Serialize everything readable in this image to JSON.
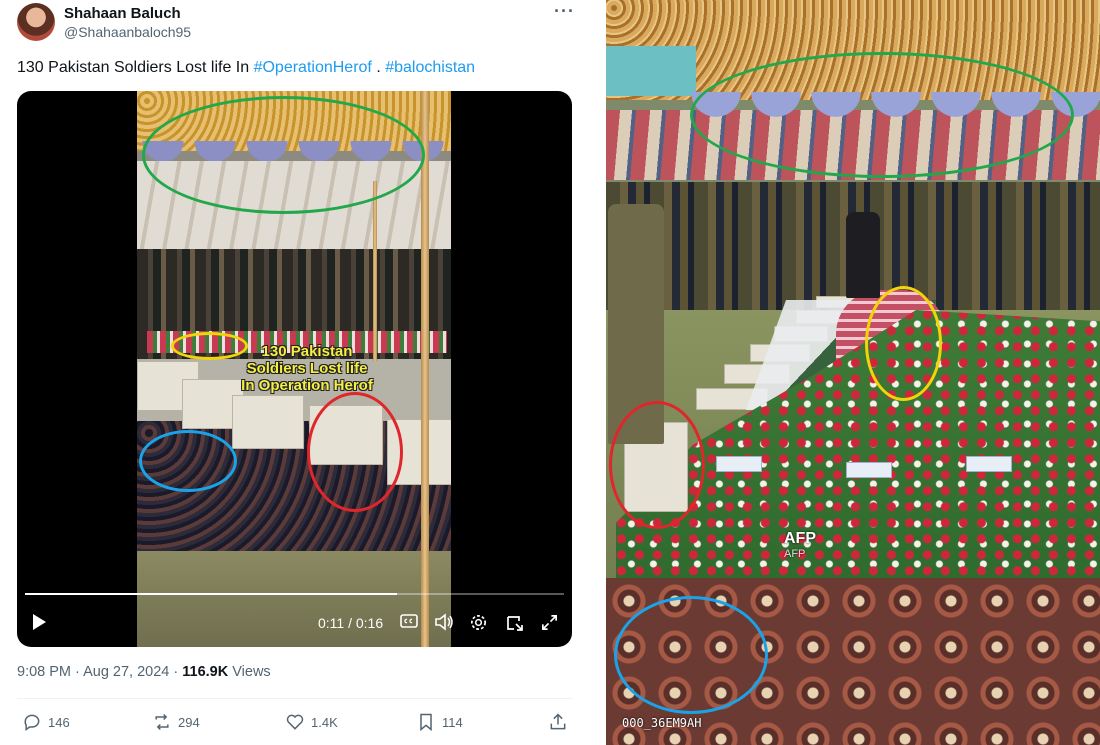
{
  "tweet": {
    "author_name": "Shahaan Baluch",
    "author_handle": "@Shahaanbaloch95",
    "more_label": "···",
    "text_prefix": "130 Pakistan Soldiers Lost life In ",
    "hashtag_1": "#OperationHerof",
    "text_sep": " . ",
    "hashtag_2": "#balochistan",
    "timestamp": "9:08 PM · Aug 27, 2024 · ",
    "views_count": "116.9K",
    "views_label": " Views",
    "actions": {
      "replies": "146",
      "reposts": "294",
      "likes": "1.4K",
      "bookmarks": "114"
    }
  },
  "video": {
    "overlay_caption": "130 Pakistan\nSoldiers Lost life\nIn Operation Herof",
    "time": "0:11 / 0:16",
    "progress_fraction": 0.69,
    "icons": [
      "play-icon",
      "captions-icon",
      "volume-icon",
      "settings-icon",
      "pip-icon",
      "fullscreen-icon"
    ]
  },
  "photo": {
    "watermark": "AFP",
    "watermark_sub": "AFP",
    "photo_id": "000_36EM9AH"
  },
  "annotation_colors": {
    "green": "#22a84a",
    "yellow": "#f3d40a",
    "red": "#e0262b",
    "blue": "#1aa3e8"
  }
}
